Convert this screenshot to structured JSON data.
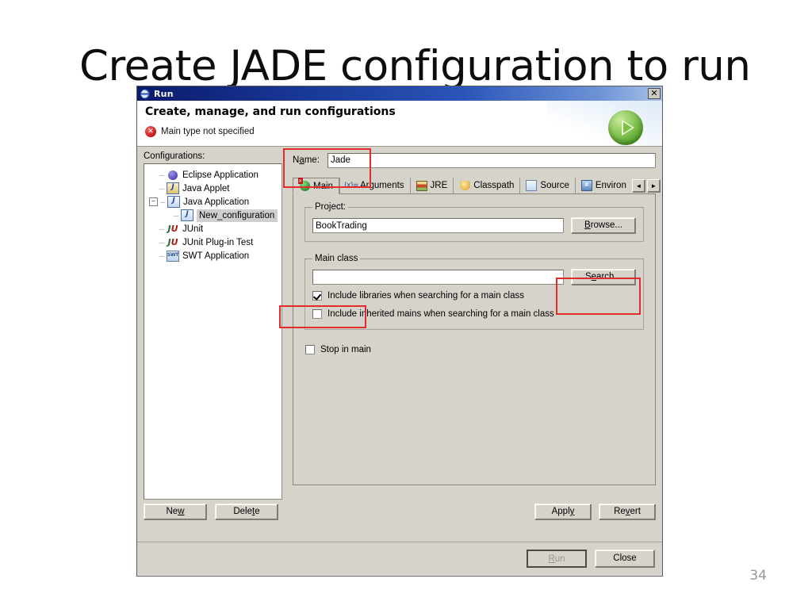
{
  "slide": {
    "title": "Create JADE configuration to run",
    "page_number": "34"
  },
  "dialog": {
    "titlebar": {
      "title": "Run",
      "icon": "eclipse-run-icon",
      "close_label": "✕"
    },
    "header": {
      "heading": "Create, manage, and run configurations",
      "message": "Main type not specified",
      "message_icon": "error-icon",
      "orb_icon": "green-run-play-icon"
    },
    "left": {
      "configurations_label": "Configurations:",
      "tree": [
        {
          "label": "Eclipse Application",
          "icon": "eclipse-application-icon",
          "level": 0,
          "expander": "none",
          "selected": false
        },
        {
          "label": "Java Applet",
          "icon": "java-applet-icon",
          "level": 0,
          "expander": "none",
          "selected": false
        },
        {
          "label": "Java Application",
          "icon": "java-application-icon",
          "level": 0,
          "expander": "minus",
          "selected": false
        },
        {
          "label": "New_configuration",
          "icon": "java-application-icon",
          "level": 1,
          "expander": "none",
          "selected": true
        },
        {
          "label": "JUnit",
          "icon": "junit-icon",
          "level": 0,
          "expander": "none",
          "selected": false
        },
        {
          "label": "JUnit Plug-in Test",
          "icon": "junit-plugin-icon",
          "level": 0,
          "expander": "none",
          "selected": false
        },
        {
          "label": "SWT Application",
          "icon": "swt-icon",
          "level": 0,
          "expander": "none",
          "selected": false
        }
      ],
      "new_button": "New",
      "delete_button": "Delete"
    },
    "right": {
      "name_label": "Name:",
      "name_value": "Jade",
      "tabs": [
        {
          "label": "Main",
          "icon": "main-tab-icon",
          "active": true
        },
        {
          "label": "Arguments",
          "icon": "arguments-tab-icon",
          "active": false
        },
        {
          "label": "JRE",
          "icon": "jre-tab-icon",
          "active": false
        },
        {
          "label": "Classpath",
          "icon": "classpath-tab-icon",
          "active": false
        },
        {
          "label": "Source",
          "icon": "source-tab-icon",
          "active": false
        },
        {
          "label": "Environ",
          "icon": "environment-tab-icon",
          "active": false
        }
      ],
      "tab_scroll_left": "◄",
      "tab_scroll_right": "►",
      "project_group_label": "Project:",
      "project_value": "BookTrading",
      "browse_button": "Browse...",
      "main_class_group_label": "Main class",
      "main_class_value": "",
      "search_button": "Search...",
      "include_libraries_label": "Include libraries when searching for a main class",
      "include_libraries_checked": true,
      "include_inherited_label": "Include inherited mains when searching for a main class",
      "include_inherited_checked": false,
      "stop_in_main_label": "Stop in main",
      "stop_in_main_checked": false,
      "apply_button": "Apply",
      "revert_button": "Revert"
    },
    "footer": {
      "run_button": "Run",
      "close_button": "Close"
    }
  },
  "annotations": {
    "highlight_color": "#e32d2d",
    "boxes": [
      {
        "name": "name-field-highlight"
      },
      {
        "name": "search-button-highlight"
      },
      {
        "name": "include-libraries-highlight"
      }
    ]
  }
}
